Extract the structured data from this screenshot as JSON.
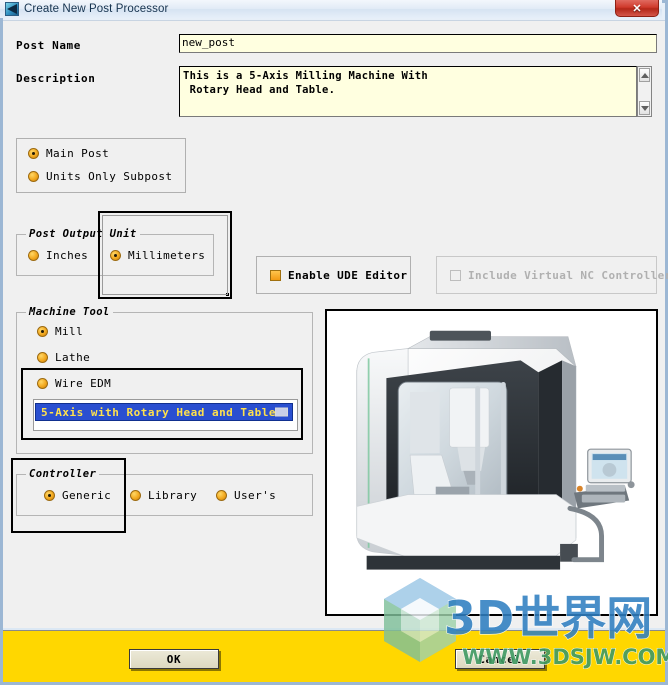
{
  "window": {
    "title": "Create New Post Processor",
    "icon": "post-processor-icon",
    "close_label": "Close"
  },
  "form": {
    "post_name_label": "Post Name",
    "post_name_value": "new_post",
    "post_name_placeholder": "",
    "description_label": "Description",
    "description_value": "This is a 5-Axis Milling Machine With\n Rotary Head and Table.",
    "description_placeholder": ""
  },
  "post_type": {
    "options": [
      {
        "label": "Main Post",
        "selected": true
      },
      {
        "label": "Units Only Subpost",
        "selected": false
      }
    ]
  },
  "post_output_unit": {
    "title": "Post Output Unit",
    "options": [
      {
        "label": "Inches",
        "selected": false
      },
      {
        "label": "Millimeters",
        "selected": true
      }
    ]
  },
  "options": {
    "enable_ude_editor": {
      "label": "Enable UDE Editor",
      "checked": true,
      "enabled": true
    },
    "include_virtual_nc": {
      "label": "Include Virtual NC Controller",
      "checked": false,
      "enabled": false
    }
  },
  "machine_tool": {
    "title": "Machine Tool",
    "options": [
      {
        "label": "Mill",
        "selected": true
      },
      {
        "label": "Lathe",
        "selected": false
      },
      {
        "label": "Wire EDM",
        "selected": false
      }
    ],
    "selected_machine": "5-Axis with Rotary Head and Table"
  },
  "controller": {
    "title": "Controller",
    "options": [
      {
        "label": "Generic",
        "selected": true
      },
      {
        "label": "Library",
        "selected": false
      },
      {
        "label": "User's",
        "selected": false
      }
    ]
  },
  "preview": {
    "alt": "5-axis CNC milling machine preview"
  },
  "footer": {
    "ok_label": "OK",
    "cancel_label": "Cancel"
  },
  "watermark": {
    "text_main": "3D世界网",
    "text_sub": "WWW.3DSJW.COM"
  },
  "colors": {
    "accent_orange": "#f2a81e",
    "selection_blue": "#2a4fd0",
    "selection_text": "#ffe14d",
    "field_bg": "#ffffe0",
    "footer_bg": "#ffd700",
    "close_red": "#cf3a2c"
  }
}
